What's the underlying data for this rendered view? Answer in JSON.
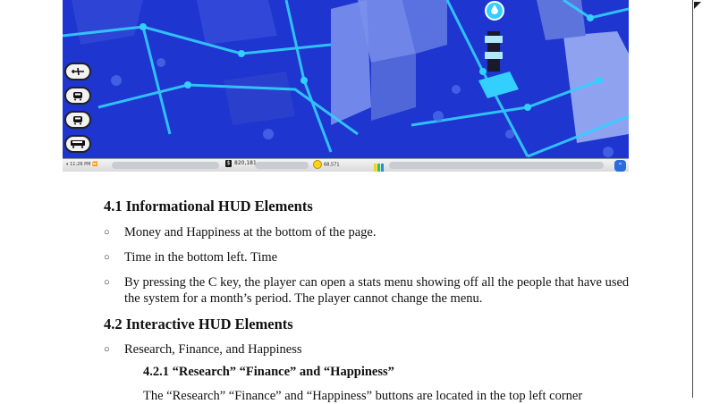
{
  "figure": {
    "hud": {
      "time": "11:26 PM",
      "money": "820,181",
      "money_symbol": "$",
      "happiness": "68,571"
    },
    "vehicle_icons": [
      "airplane-icon",
      "train-icon",
      "train-icon",
      "bus-icon"
    ],
    "colors": {
      "scene_blue": "#1a2fc8",
      "road_cyan": "#33d0ff",
      "hud_bg": "#e6e6e6"
    }
  },
  "section_41": {
    "title": "4.1 Informational HUD Elements",
    "bullets": [
      "Money and Happiness at the bottom of the page.",
      "Time in the bottom left. Time",
      "By pressing the C key, the player can open a stats menu showing off all the people that have used the system for a month’s period. The player cannot change the menu."
    ]
  },
  "section_42": {
    "title": "4.2 Interactive HUD Elements",
    "bullets": [
      "Research, Finance, and Happiness"
    ],
    "subsection": {
      "title": "4.2.1 “Research” “Finance” and “Happiness”",
      "text": "The “Research” “Finance” and “Happiness” buttons are located in the top left corner"
    }
  },
  "bullet_symbol": "○"
}
